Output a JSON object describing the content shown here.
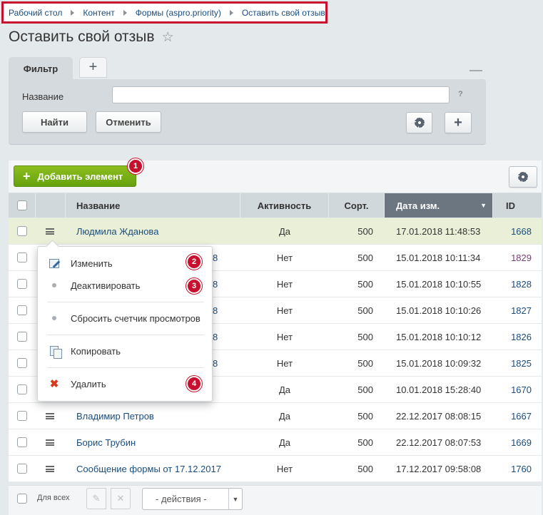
{
  "breadcrumb": [
    "Рабочий стол",
    "Контент",
    "Формы (aspro.priority)",
    "Оставить свой отзыв"
  ],
  "page_title": "Оставить свой отзыв",
  "filter": {
    "tab_label": "Фильтр",
    "field_label": "Название",
    "field_value": "",
    "help": "?",
    "find_label": "Найти",
    "cancel_label": "Отменить"
  },
  "toolbar": {
    "add_label": "Добавить элемент"
  },
  "badges": [
    "1",
    "2",
    "3",
    "4"
  ],
  "table": {
    "columns": [
      "Название",
      "Активность",
      "Сорт.",
      "Дата изм.",
      "ID"
    ],
    "rows": [
      {
        "name": "Людмила Жданова",
        "active": "Да",
        "sort": "500",
        "date": "17.01.2018 11:48:53",
        "id": "1668"
      },
      {
        "name": "8",
        "active": "Нет",
        "sort": "500",
        "date": "15.01.2018 10:11:34",
        "id": "1829"
      },
      {
        "name": "8",
        "active": "Нет",
        "sort": "500",
        "date": "15.01.2018 10:10:55",
        "id": "1828"
      },
      {
        "name": "8",
        "active": "Нет",
        "sort": "500",
        "date": "15.01.2018 10:10:26",
        "id": "1827"
      },
      {
        "name": "8",
        "active": "Нет",
        "sort": "500",
        "date": "15.01.2018 10:10:12",
        "id": "1826"
      },
      {
        "name": "8",
        "active": "Нет",
        "sort": "500",
        "date": "15.01.2018 10:09:32",
        "id": "1825"
      },
      {
        "name": "",
        "active": "Да",
        "sort": "500",
        "date": "10.01.2018 15:28:40",
        "id": "1670"
      },
      {
        "name": "Владимир Петров",
        "active": "Да",
        "sort": "500",
        "date": "22.12.2017 08:08:15",
        "id": "1667"
      },
      {
        "name": "Борис Трубин",
        "active": "Да",
        "sort": "500",
        "date": "22.12.2017 08:07:53",
        "id": "1669"
      },
      {
        "name": "Сообщение формы от 17.12.2017",
        "active": "Нет",
        "sort": "500",
        "date": "17.12.2017 09:58:08",
        "id": "1760"
      }
    ]
  },
  "context_menu": {
    "items": [
      "Изменить",
      "Деактивировать",
      "Сбросить счетчик просмотров",
      "Копировать",
      "Удалить"
    ]
  },
  "footer": {
    "for_all": "Для всех",
    "actions_placeholder": "- действия -"
  },
  "colors": {
    "accent_green": "#6aa512",
    "badge_red": "#c8102e",
    "link": "#1a4d7e",
    "visited_link": "#7b3f7b",
    "highlight_row": "#eaf0d8"
  },
  "icons": [
    "star-icon",
    "plus-icon",
    "minus-icon",
    "gear-icon",
    "burger-icon",
    "edit-icon",
    "dot-icon",
    "copy-icon",
    "delete-icon",
    "pencil-icon",
    "close-icon",
    "chevron-down-icon"
  ]
}
